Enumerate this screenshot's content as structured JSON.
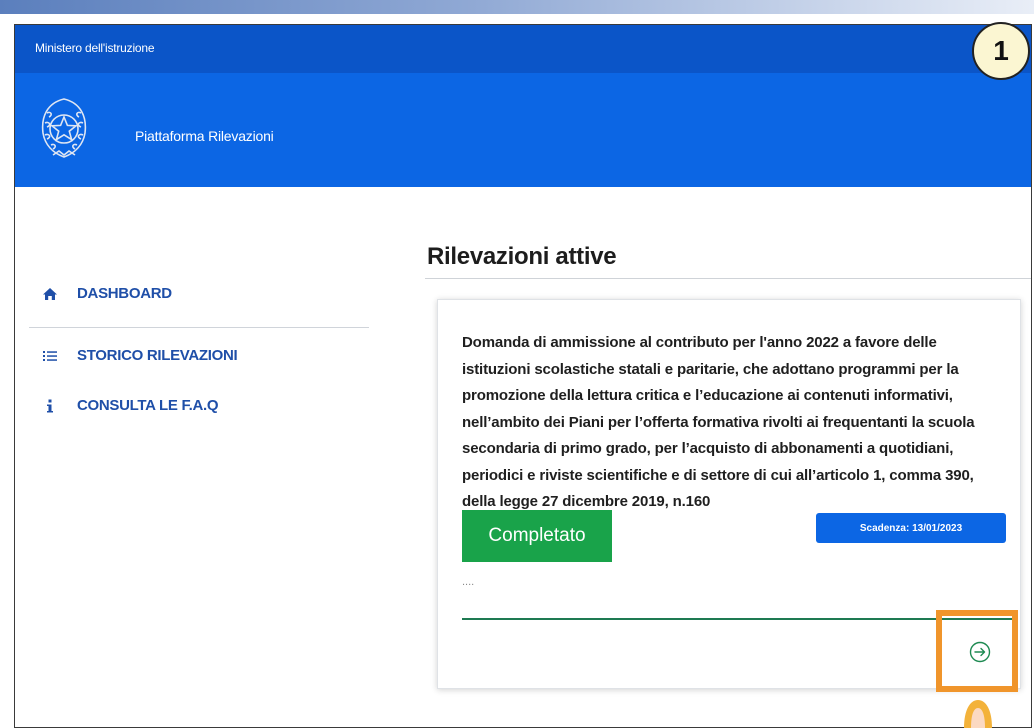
{
  "header": {
    "ministry": "Ministero dell'istruzione",
    "platform": "Piattaforma Rilevazioni",
    "emblem_icon": "italian-republic-emblem"
  },
  "sidebar": {
    "items": [
      {
        "label": "DASHBOARD",
        "icon": "home-icon"
      },
      {
        "label": "STORICO RILEVAZIONI",
        "icon": "list-icon"
      },
      {
        "label": "CONSULTA LE F.A.Q",
        "icon": "info-icon"
      }
    ]
  },
  "main": {
    "title": "Rilevazioni attive",
    "card": {
      "description": "Domanda di ammissione al contributo per l'anno 2022 a favore delle istituzioni scolastiche statali e paritarie, che adottano programmi per la promozione della lettura critica e l’educazione ai contenuti informativi, nell’ambito dei Piani per l’offerta formativa rivolti ai frequentanti la scuola secondaria di primo grado, per l’acquisto di abbonamenti a quotidiani, periodici e riviste scientifiche e di settore di cui all’articolo 1, comma 390, della legge 27 dicembre 2019, n.160",
      "status": "Completato",
      "deadline": "Scadenza: 13/01/2023",
      "ellipsis": "....",
      "action_icon": "arrow-right-circle-icon"
    }
  },
  "annotation": {
    "step": "1"
  },
  "colors": {
    "header_dark": "#0b55c8",
    "header": "#0c66e4",
    "nav_text": "#1f4fa8",
    "status_green": "#19a34a",
    "highlight_orange": "#f0952b"
  }
}
